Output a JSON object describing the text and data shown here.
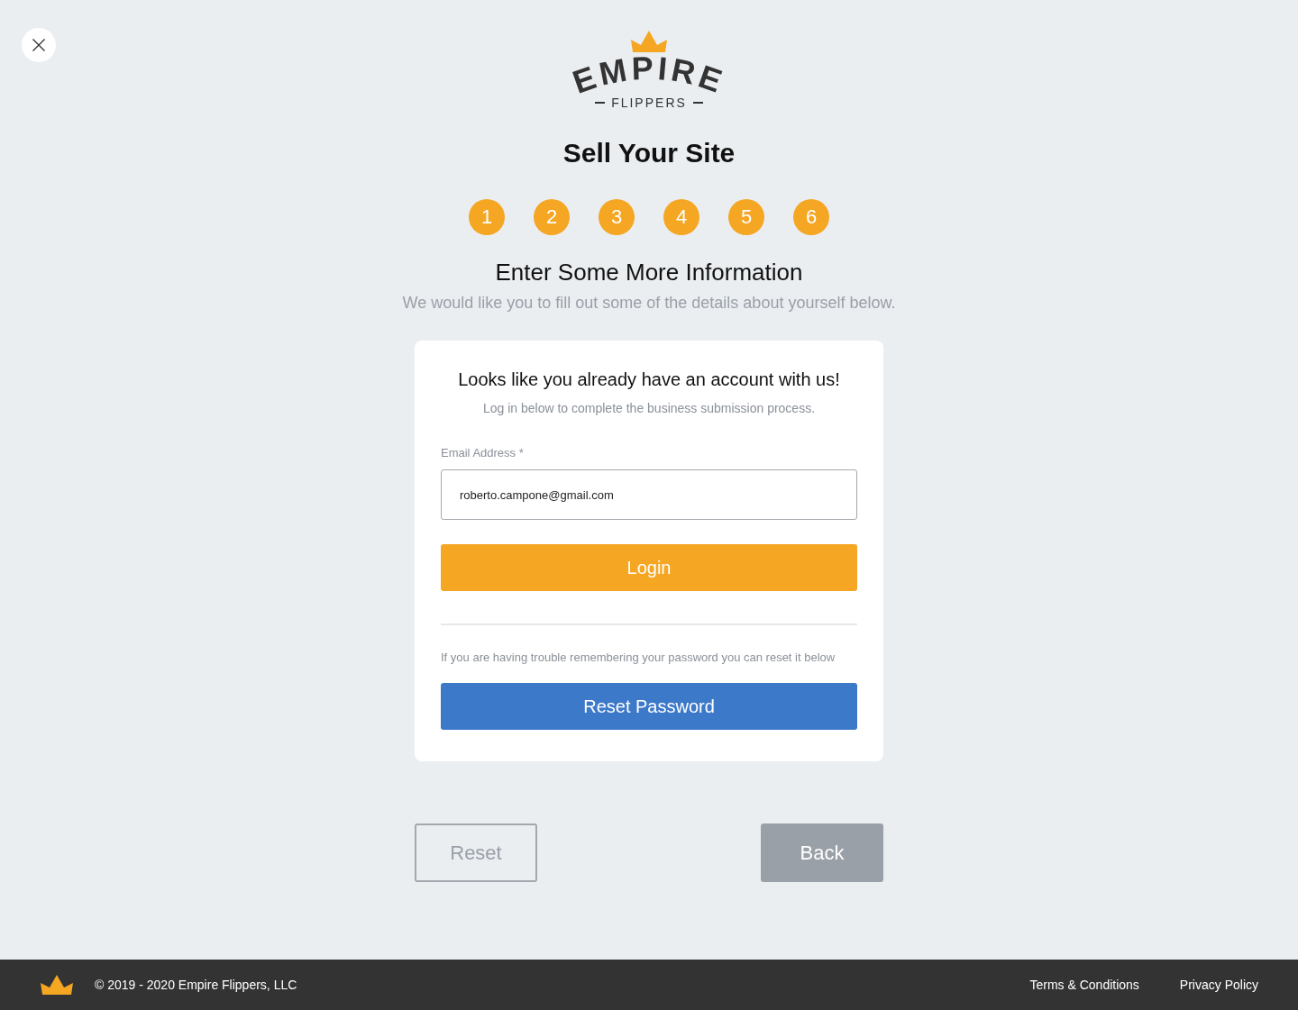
{
  "logo": {
    "wordmark": "EMPIRE",
    "tagline": "FLIPPERS"
  },
  "title": "Sell Your Site",
  "steps": [
    "1",
    "2",
    "3",
    "4",
    "5",
    "6"
  ],
  "section": {
    "heading": "Enter Some More Information",
    "subtitle": "We would like you to fill out some of the details about yourself below."
  },
  "card": {
    "heading": "Looks like you already have an account with us!",
    "subtext": "Log in below to complete the business submission process.",
    "email_field": {
      "label": "Email Address *",
      "value": "roberto.campone@gmail.com"
    },
    "login_button": "Login",
    "help_text": "If you are having trouble remembering your password you can reset it below",
    "reset_password_button": "Reset Password"
  },
  "buttons": [
    {
      "label": "Reset",
      "kind": "outline"
    },
    {
      "label": "Back",
      "kind": "filled"
    }
  ],
  "footer": {
    "copyright": "© 2019 - 2020 Empire Flippers, LLC",
    "links": [
      "Terms & Conditions",
      "Privacy Policy"
    ]
  }
}
